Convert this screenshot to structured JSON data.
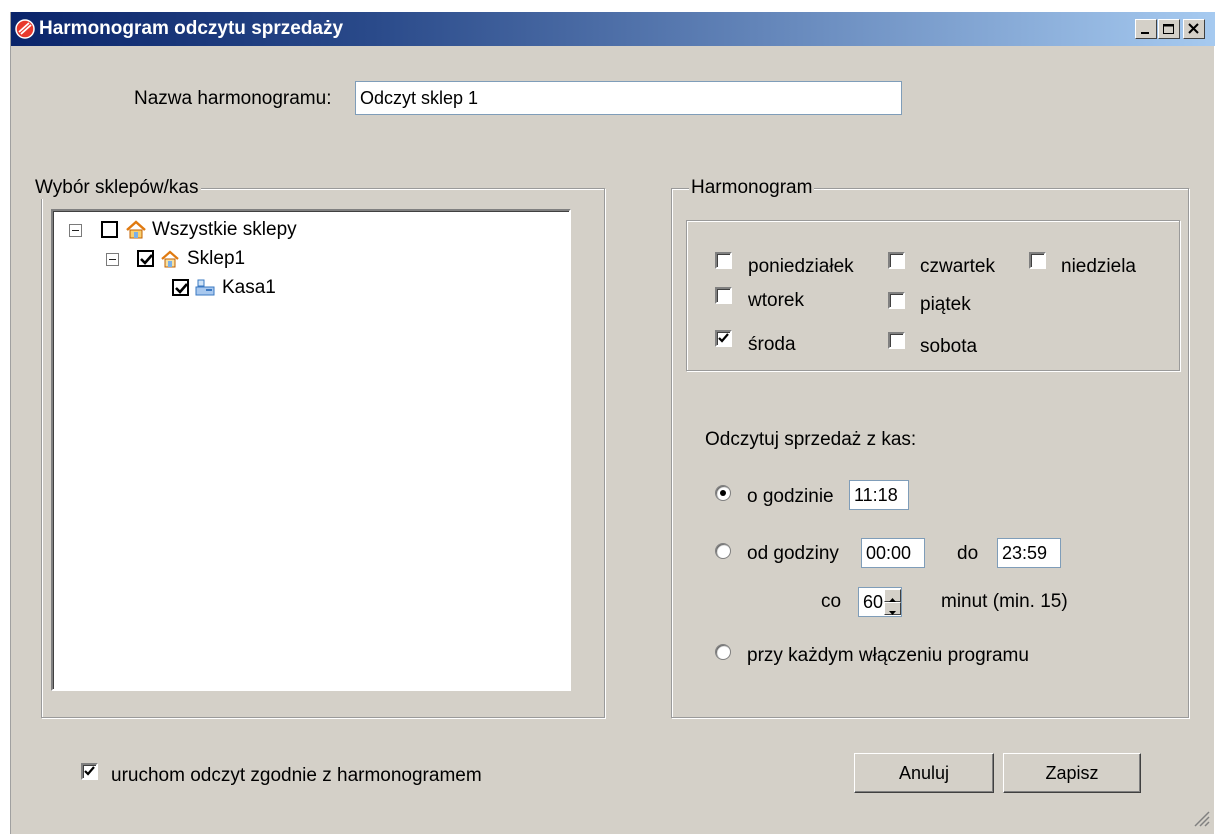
{
  "window": {
    "title": "Harmonogram odczytu sprzedaży",
    "controls": [
      "minimize-icon",
      "maximize-icon",
      "close-icon"
    ]
  },
  "schedule_name": {
    "label": "Nazwa harmonogramu:",
    "value": "Odczyt sklep 1"
  },
  "stores": {
    "group_label": "Wybór sklepów/kas",
    "tree": [
      {
        "label": "Wszystkie sklepy",
        "checked": false,
        "expanded": true,
        "icon": "store-group-icon"
      },
      {
        "label": "Sklep1",
        "checked": true,
        "expanded": true,
        "icon": "store-icon"
      },
      {
        "label": "Kasa1",
        "checked": true,
        "icon": "cash-register-icon"
      }
    ]
  },
  "schedule": {
    "group_label": "Harmonogram",
    "days": [
      {
        "label": "poniedziałek",
        "checked": false
      },
      {
        "label": "wtorek",
        "checked": false
      },
      {
        "label": "środa",
        "checked": true
      },
      {
        "label": "czwartek",
        "checked": false
      },
      {
        "label": "piątek",
        "checked": false
      },
      {
        "label": "sobota",
        "checked": false
      },
      {
        "label": "niedziela",
        "checked": false
      }
    ],
    "read_label": "Odczytuj sprzedaż z kas:",
    "option_at_hour": {
      "label": "o godzinie",
      "value": "11:18",
      "selected": true
    },
    "option_range": {
      "label": "od godziny",
      "from": "00:00",
      "to_label": "do",
      "to": "23:59",
      "every_label": "co",
      "every": "60",
      "unit_label": "minut (min. 15)",
      "selected": false
    },
    "option_startup": {
      "label": "przy każdym włączeniu programu",
      "selected": false
    }
  },
  "run_by_schedule": {
    "label": "uruchom odczyt zgodnie z harmonogramem",
    "checked": true
  },
  "buttons": {
    "cancel": "Anuluj",
    "save": "Zapisz"
  },
  "colors": {
    "titlebar_start": "#0a246a",
    "titlebar_end": "#a6caf0",
    "dialog_bg": "#d4d0c8"
  }
}
